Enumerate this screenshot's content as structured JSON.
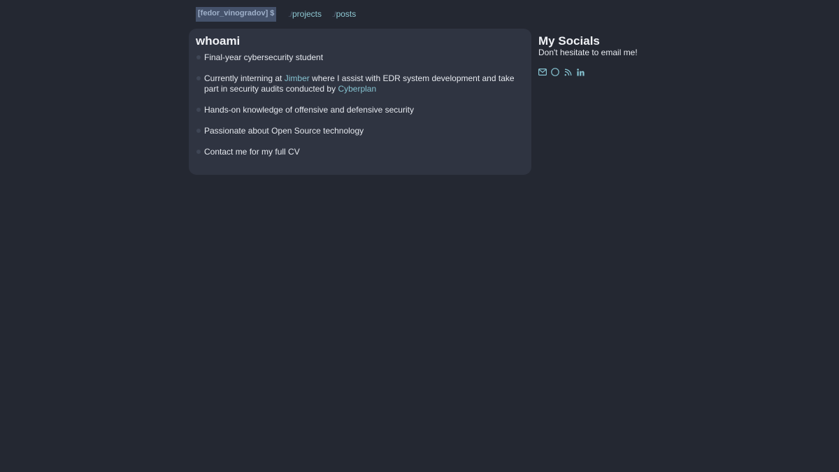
{
  "nav": {
    "brand": "[fedor_vinogradov] $",
    "links": [
      {
        "prefix": "./",
        "label": "projects"
      },
      {
        "prefix": "./",
        "label": "posts"
      }
    ]
  },
  "about": {
    "title": "whoami",
    "items": [
      {
        "text": "Final-year cybersecurity student"
      },
      {
        "pre": "Currently interning at ",
        "link1": "Jimber",
        "mid": " where I assist with EDR system development and take part in security audits conducted by ",
        "link2": "Cyberplan"
      },
      {
        "text": "Hands-on knowledge of offensive and defensive security"
      },
      {
        "text": "Passionate about Open Source technology"
      },
      {
        "text": "Contact me for my full CV"
      }
    ]
  },
  "socials": {
    "title": "My Socials",
    "subtitle": "Don't hesitate to email me!",
    "icons": [
      "mail-icon",
      "github-icon",
      "rss-icon",
      "linkedin-icon"
    ]
  },
  "colors": {
    "background": "#242832",
    "card": "#2f3441",
    "accent": "#86c3d1",
    "brand_bg": "#45526b"
  }
}
